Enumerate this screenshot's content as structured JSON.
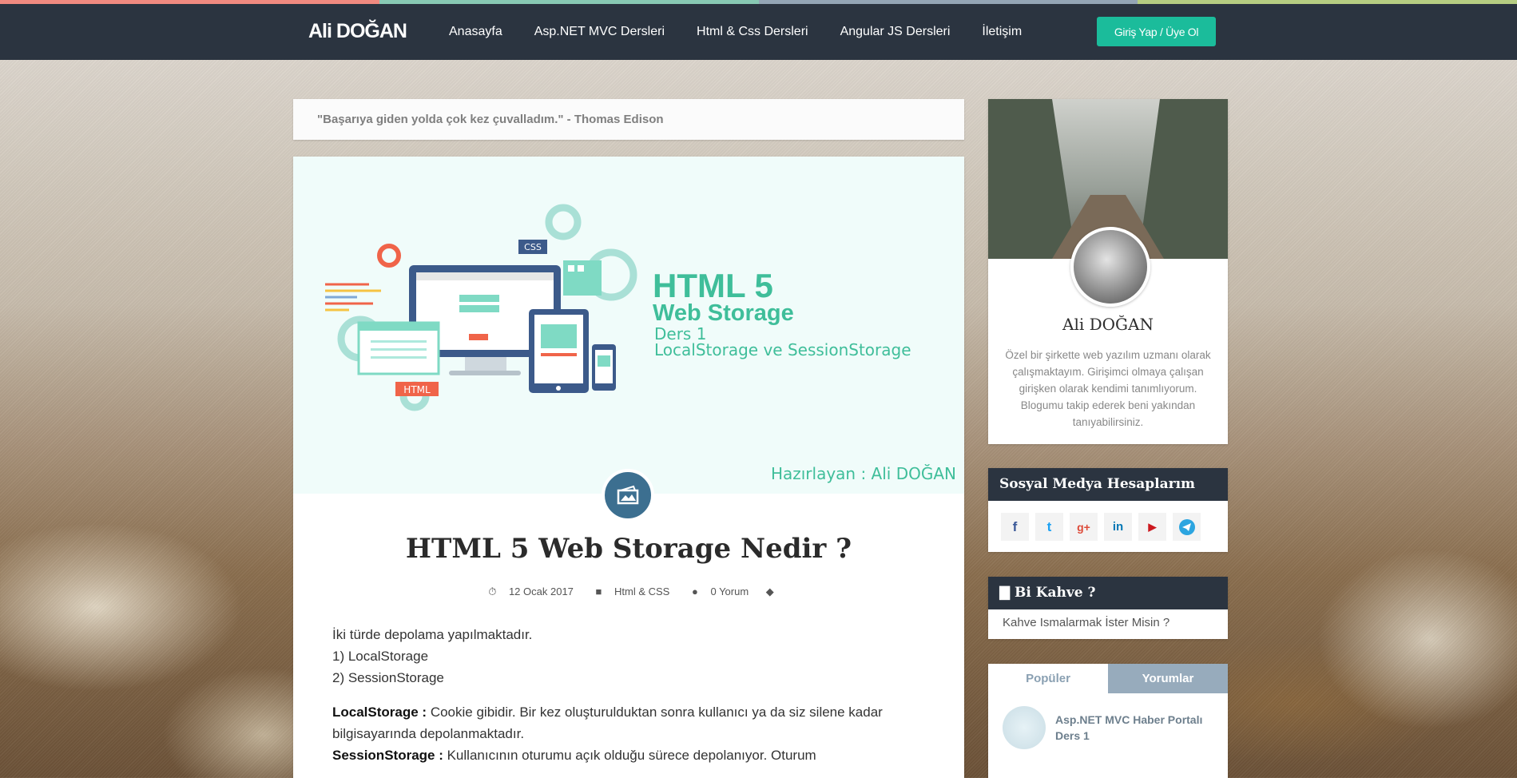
{
  "colors": {
    "navbar": "#2b3440",
    "accent_button": "#1bbc9b",
    "hero_text": "#3fbe9a",
    "post_icon_bg": "#3c6f90",
    "topstripe": [
      "#f08a80",
      "#88c9b4",
      "#94a5b5",
      "#b6cd82"
    ]
  },
  "header": {
    "brand": "Ali DOĞAN",
    "nav": [
      "Anasayfa",
      "Asp.NET MVC Dersleri",
      "Html & Css Dersleri",
      "Angular JS Dersleri",
      "İletişim"
    ],
    "login_label": "Giriş Yap / Üye Ol"
  },
  "quote": "\"Başarıya giden yolda çok kez çuvalladım.\" - Thomas Edison",
  "post": {
    "hero": {
      "badge_css": "CSS",
      "badge_html": "HTML",
      "line1": "HTML 5",
      "line2": "Web Storage",
      "line3": "Ders 1",
      "line4": "LocalStorage ve SessionStorage",
      "author": "Hazırlayan : Ali DOĞAN"
    },
    "icon": "image-post-icon",
    "title": "HTML 5 Web Storage Nedir ?",
    "meta": {
      "date": "12 Ocak 2017",
      "category": "Html & CSS",
      "comments": "0 Yorum"
    },
    "body": {
      "intro": "İki türde depolama yapılmaktadır.",
      "item1": "1) LocalStorage",
      "item2": "2) SessionStorage",
      "local_label": "LocalStorage :",
      "local_text": " Cookie gibidir. Bir kez oluşturulduktan sonra kullanıcı ya da siz silene kadar bilgisayarında depolanmaktadır.",
      "session_label": "SessionStorage :",
      "session_text": " Kullanıcının oturumu açık olduğu sürece depolanıyor. Oturum"
    }
  },
  "sidebar": {
    "profile": {
      "name": "Ali DOĞAN",
      "bio": "Özel bir şirkette web yazılım uzmanı olarak çalışmaktayım. Girişimci olmaya çalışan girişken olarak kendimi tanımlıyorum. Blogumu takip ederek beni yakından tanıyabilirsiniz."
    },
    "social": {
      "title": "Sosyal Medya Hesaplarım",
      "icons": [
        "facebook-icon",
        "twitter-icon",
        "google-plus-icon",
        "linkedin-icon",
        "youtube-icon",
        "telegram-icon"
      ]
    },
    "coffee": {
      "title": "Bi Kahve ?",
      "text": "Kahve Ismalarmak İster Misin ?"
    },
    "tabs": {
      "popular": "Popüler",
      "comments": "Yorumlar",
      "items": [
        {
          "title": "Asp.NET MVC Haber Portalı Ders 1"
        }
      ]
    }
  }
}
